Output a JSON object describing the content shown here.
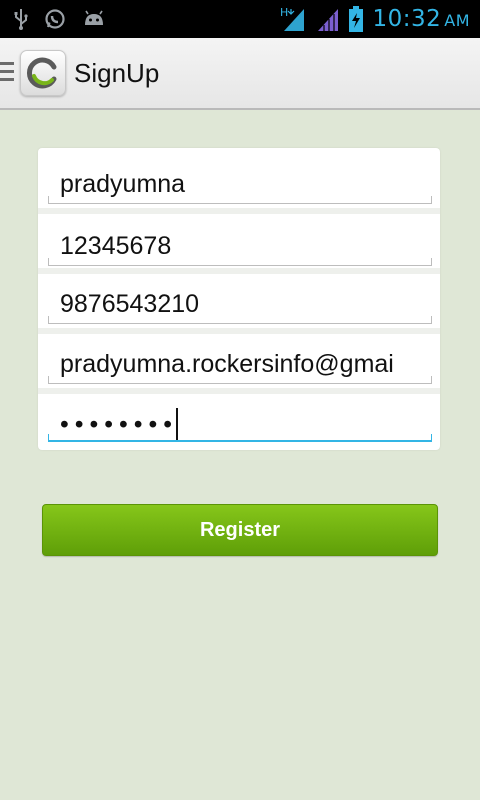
{
  "status_bar": {
    "time": "10:32",
    "ampm": "AM",
    "left_icons": [
      "usb-icon",
      "whatsapp-icon",
      "android-debug-icon"
    ],
    "right_icons": [
      "signal-h-icon",
      "signal-bars-icon",
      "battery-charging-icon"
    ],
    "signal_label": "H"
  },
  "action_bar": {
    "title": "SignUp",
    "logo_icon": "app-logo-icon"
  },
  "form": {
    "fields": [
      {
        "name": "name",
        "value": "pradyumna"
      },
      {
        "name": "code",
        "value": "12345678"
      },
      {
        "name": "phone",
        "value": "9876543210"
      },
      {
        "name": "email",
        "value": "pradyumna.rockersinfo@gmai"
      },
      {
        "name": "password",
        "value": "••••••••"
      }
    ],
    "accent_color": "#33b5e5"
  },
  "register_button": {
    "label": "Register",
    "color": "#72b311"
  },
  "colors": {
    "background": "#dfe7d6",
    "status_accent": "#33b5e5"
  }
}
